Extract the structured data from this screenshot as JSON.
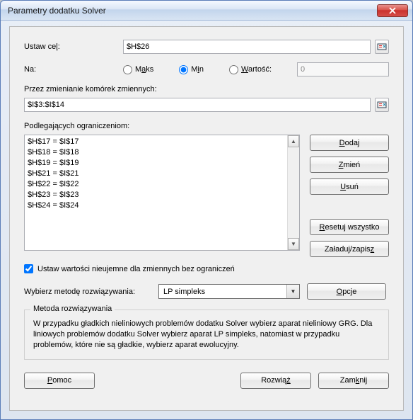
{
  "window": {
    "title": "Parametry dodatku Solver"
  },
  "target": {
    "label_prefix": "Ustaw ce",
    "label_key": "l",
    "label_suffix": ":",
    "value": "$H$26"
  },
  "objective": {
    "label": "Na:",
    "max_prefix": "M",
    "max_key": "a",
    "max_suffix": "ks",
    "min_prefix": "M",
    "min_key": "i",
    "min_suffix": "n",
    "value_label_key": "W",
    "value_label_suffix": "artość:",
    "value_input": "0",
    "selected": "min"
  },
  "vars": {
    "label": "Przez zmienianie komórek zmiennych:",
    "value": "$I$3:$I$14"
  },
  "constraints": {
    "label": "Podlegających ograniczeniom:",
    "items": [
      "$H$17 = $I$17",
      "$H$18 = $I$18",
      "$H$19 = $I$19",
      "$H$21 = $I$21",
      "$H$22 = $I$22",
      "$H$23 = $I$23",
      "$H$24 = $I$24"
    ],
    "buttons": {
      "add_key": "D",
      "add_suffix": "odaj",
      "change_key": "Z",
      "change_suffix": "mień",
      "delete_key": "U",
      "delete_suffix": "suń",
      "reset_key": "R",
      "reset_suffix": "esetuj wszystko",
      "loadsave_prefix": "Załaduj/zapis",
      "loadsave_key": "z"
    }
  },
  "nonneg": {
    "label": "Ustaw wartości nieujemne dla zmiennych bez ograniczeń",
    "checked": true
  },
  "method": {
    "label": "Wybierz metodę rozwiązywania:",
    "value": "LP simpleks",
    "options_key": "O",
    "options_label": "pcje"
  },
  "group": {
    "title": "Metoda rozwiązywania",
    "body": "W przypadku gładkich nieliniowych problemów dodatku Solver wybierz aparat nieliniowy GRG. Dla liniowych problemów dodatku Solver wybierz aparat LP simpleks, natomiast w przypadku problemów, które nie są gładkie, wybierz aparat ewolucyjny."
  },
  "footer": {
    "help_key": "P",
    "help_suffix": "omoc",
    "solve_prefix": "Rozwią",
    "solve_key": "ż",
    "close_prefix": "Zam",
    "close_key": "k",
    "close_suffix": "nij"
  }
}
